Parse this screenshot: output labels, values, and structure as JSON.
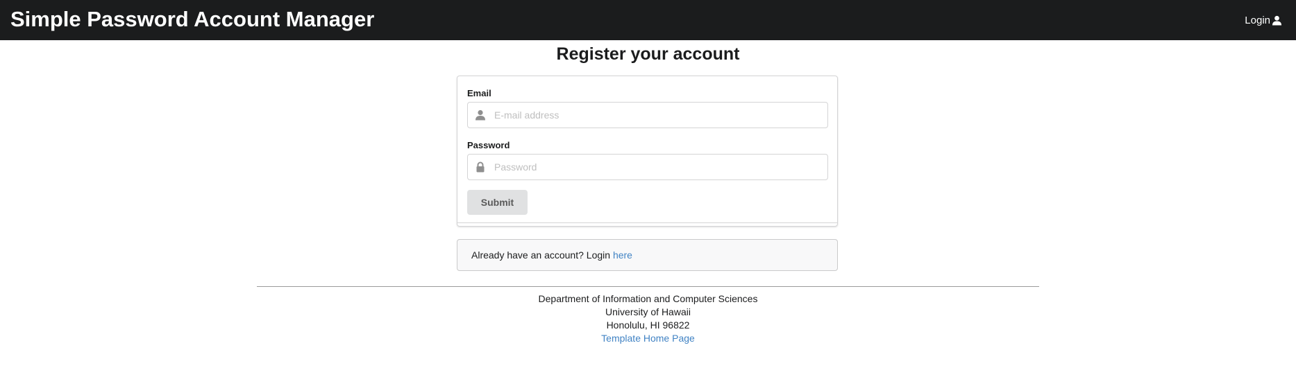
{
  "navbar": {
    "brand": "Simple Password Account Manager",
    "login_label": "Login",
    "login_icon": "user-icon"
  },
  "page": {
    "title": "Register your account"
  },
  "form": {
    "email_label": "Email",
    "email_placeholder": "E-mail address",
    "email_value": "",
    "email_icon": "user-icon",
    "password_label": "Password",
    "password_placeholder": "Password",
    "password_value": "",
    "password_icon": "lock-icon",
    "submit_label": "Submit"
  },
  "message": {
    "text": "Already have an account? Login ",
    "link_label": "here"
  },
  "footer": {
    "line1": "Department of Information and Computer Sciences",
    "line2": "University of Hawaii",
    "line3": "Honolulu, HI 96822",
    "link_label": "Template Home Page"
  },
  "colors": {
    "navbar_bg": "#1b1c1d",
    "link": "#4183c4",
    "button_bg": "#e0e1e2",
    "message_bg": "#f8f8f9"
  }
}
